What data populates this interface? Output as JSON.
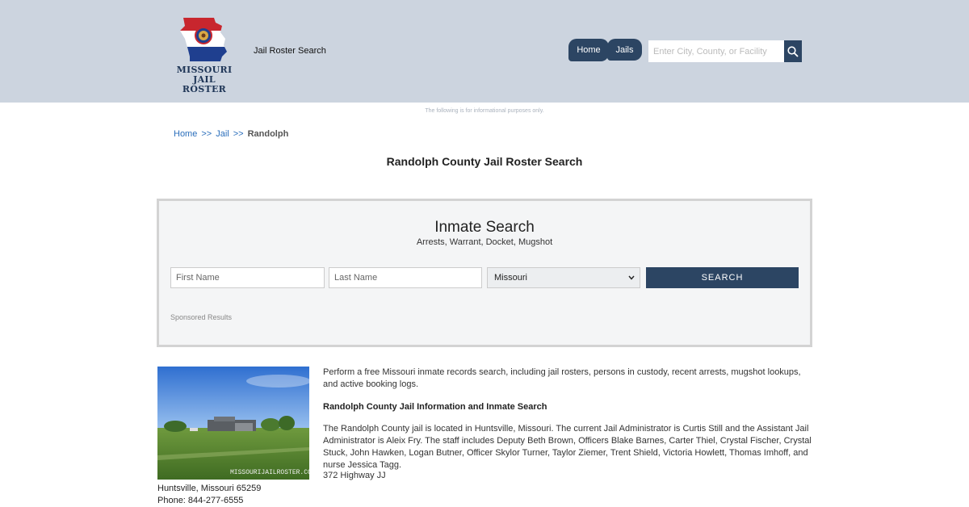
{
  "header": {
    "logo_line1": "MISSOURI",
    "logo_line2": "JAIL ROSTER",
    "site_title": "Jail Roster Search",
    "nav": {
      "home": "Home",
      "jails": "Jails"
    },
    "search_placeholder": "Enter City, County, or Facility",
    "search_icon": "magnifier-icon"
  },
  "disclaimer": "The following is for informational purposes only.",
  "breadcrumb": {
    "home": "Home",
    "sep": ">>",
    "jail": "Jail",
    "current": "Randolph"
  },
  "page_title": "Randolph County Jail Roster Search",
  "inmate_search": {
    "title": "Inmate Search",
    "subtitle": "Arrests, Warrant, Docket, Mugshot",
    "first_name_placeholder": "First Name",
    "last_name_placeholder": "Last Name",
    "state_selected": "Missouri",
    "search_button": "SEARCH",
    "sponsored": "Sponsored Results"
  },
  "facility": {
    "watermark": "MISSOURIJAILROSTER.COM",
    "address_line": "Huntsville, Missouri 65259",
    "phone": "Phone: 844-277-6555"
  },
  "content": {
    "intro": "Perform a free Missouri inmate records search, including jail rosters, persons in custody, recent arrests, mugshot lookups, and active booking logs.",
    "heading": "Randolph County Jail Information and Inmate Search",
    "body": "The Randolph County jail is located in Huntsville, Missouri. The current Jail Administrator is Curtis Still and the Assistant Jail Administrator is Aleix Fry. The staff includes Deputy Beth Brown, Officers Blake Barnes, Carter Thiel, Crystal Fischer, Crystal Stuck, John Hawken, Logan Butner, Officer Skylor Turner, Taylor Ziemer, Trent Shield, Victoria Howlett, Thomas Imhoff, and nurse Jessica Tagg.",
    "street": "372 Highway JJ"
  },
  "colors": {
    "header_bg": "#ccd4df",
    "accent": "#2c4563",
    "link": "#2a6ebb"
  }
}
